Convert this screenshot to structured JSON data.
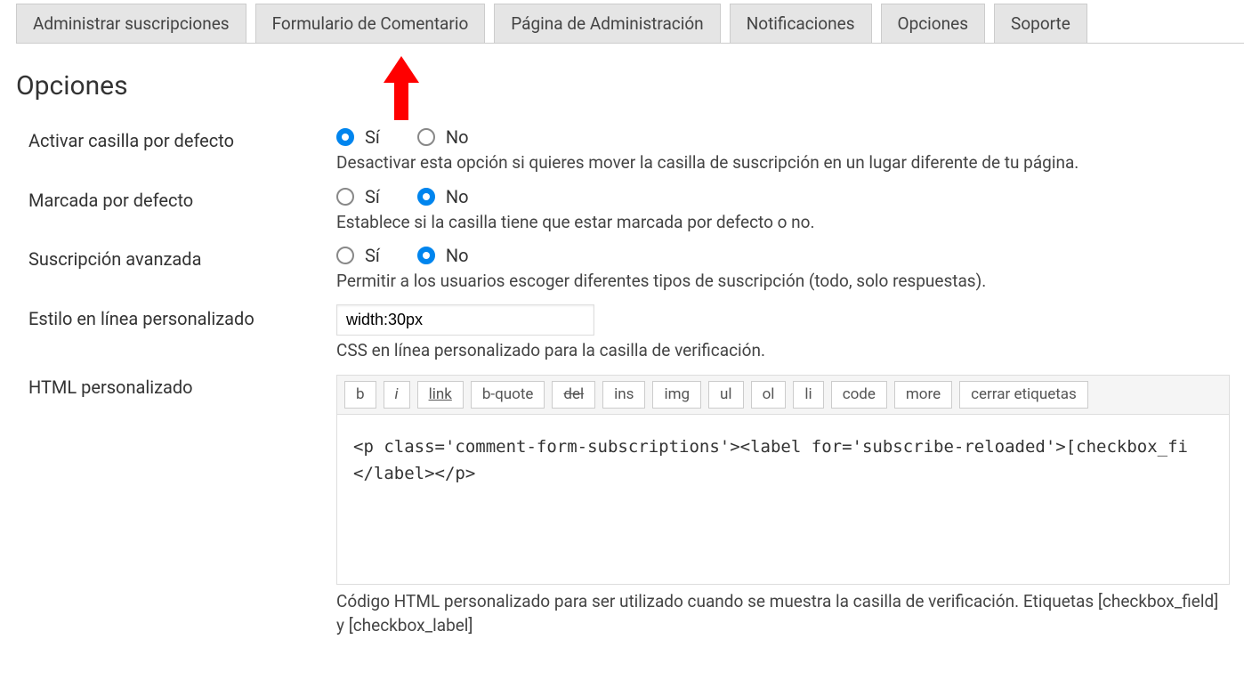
{
  "tabs": {
    "items": [
      "Administrar suscripciones",
      "Formulario de Comentario",
      "Página de Administración",
      "Notificaciones",
      "Opciones",
      "Soporte"
    ]
  },
  "page_title": "Opciones",
  "yes_label": "Sí",
  "no_label": "No",
  "opt_enable": {
    "label": "Activar casilla por defecto",
    "value": "yes",
    "desc": "Desactivar esta opción si quieres mover la casilla de suscripción en un lugar diferente de tu página."
  },
  "opt_checked": {
    "label": "Marcada por defecto",
    "value": "no",
    "desc": "Establece si la casilla tiene que estar marcada por defecto o no."
  },
  "opt_advanced": {
    "label": "Suscripción avanzada",
    "value": "no",
    "desc": "Permitir a los usuarios escoger diferentes tipos de suscripción (todo, solo respuestas)."
  },
  "opt_style": {
    "label": "Estilo en línea personalizado",
    "value": "width:30px",
    "desc": "CSS en línea personalizado para la casilla de verificación."
  },
  "opt_html": {
    "label": "HTML personalizado",
    "toolbar": [
      "b",
      "i",
      "link",
      "b-quote",
      "del",
      "ins",
      "img",
      "ul",
      "ol",
      "li",
      "code",
      "more",
      "cerrar etiquetas"
    ],
    "content": "<p class='comment-form-subscriptions'><label for='subscribe-reloaded'>[checkbox_fi\n</label></p>",
    "desc": "Código HTML personalizado para ser utilizado cuando se muestra la casilla de verificación. Etiquetas [checkbox_field] y [checkbox_label]"
  }
}
